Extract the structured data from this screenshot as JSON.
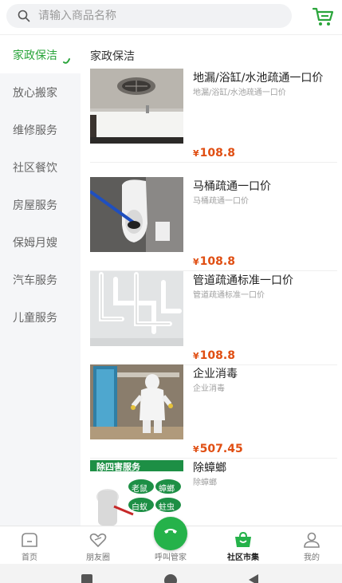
{
  "search": {
    "placeholder": "请输入商品名称"
  },
  "sidebar": {
    "items": [
      {
        "label": "家政保洁",
        "active": true
      },
      {
        "label": "放心搬家"
      },
      {
        "label": "维修服务"
      },
      {
        "label": "社区餐饮"
      },
      {
        "label": "房屋服务"
      },
      {
        "label": "保姆月嫂"
      },
      {
        "label": "汽车服务"
      },
      {
        "label": "儿童服务"
      }
    ]
  },
  "content": {
    "category_title": "家政保洁",
    "products": [
      {
        "name": "地漏/浴缸/水池疏通一口价",
        "subtitle": "地漏/浴缸/水池疏通一口价",
        "currency": "¥",
        "price": "108.8",
        "image": "sink-drain-photo"
      },
      {
        "name": "马桶疏通一口价",
        "subtitle": "马桶疏通一口价",
        "currency": "¥",
        "price": "108.8",
        "image": "toilet-plunger-photo"
      },
      {
        "name": "管道疏通标准一口价",
        "subtitle": "管道疏通标准一口价",
        "currency": "¥",
        "price": "108.8",
        "image": "white-pipes-photo"
      },
      {
        "name": "企业消毒",
        "subtitle": "企业消毒",
        "currency": "¥",
        "price": "507.45",
        "image": "disinfection-worker-photo"
      },
      {
        "name": "除蟑螂",
        "subtitle": "除蟑螂",
        "currency": "",
        "price": "",
        "image": "pest-control-poster",
        "poster_text": {
          "banner": "除四害服务",
          "tags": [
            "老鼠",
            "蟑螂",
            "白蚁",
            "蛀虫"
          ]
        }
      }
    ]
  },
  "bottom_nav": {
    "items": [
      {
        "label": "首页",
        "icon": "home-icon"
      },
      {
        "label": "朋友圈",
        "icon": "friends-heart-icon"
      },
      {
        "label": "呼叫管家",
        "icon": "phone-icon"
      },
      {
        "label": "社区市集",
        "icon": "basket-icon",
        "active": true
      },
      {
        "label": "我的",
        "icon": "user-icon"
      }
    ]
  },
  "colors": {
    "accent": "#2aa53b",
    "price": "#e04e12",
    "call_button": "#25b24a"
  }
}
